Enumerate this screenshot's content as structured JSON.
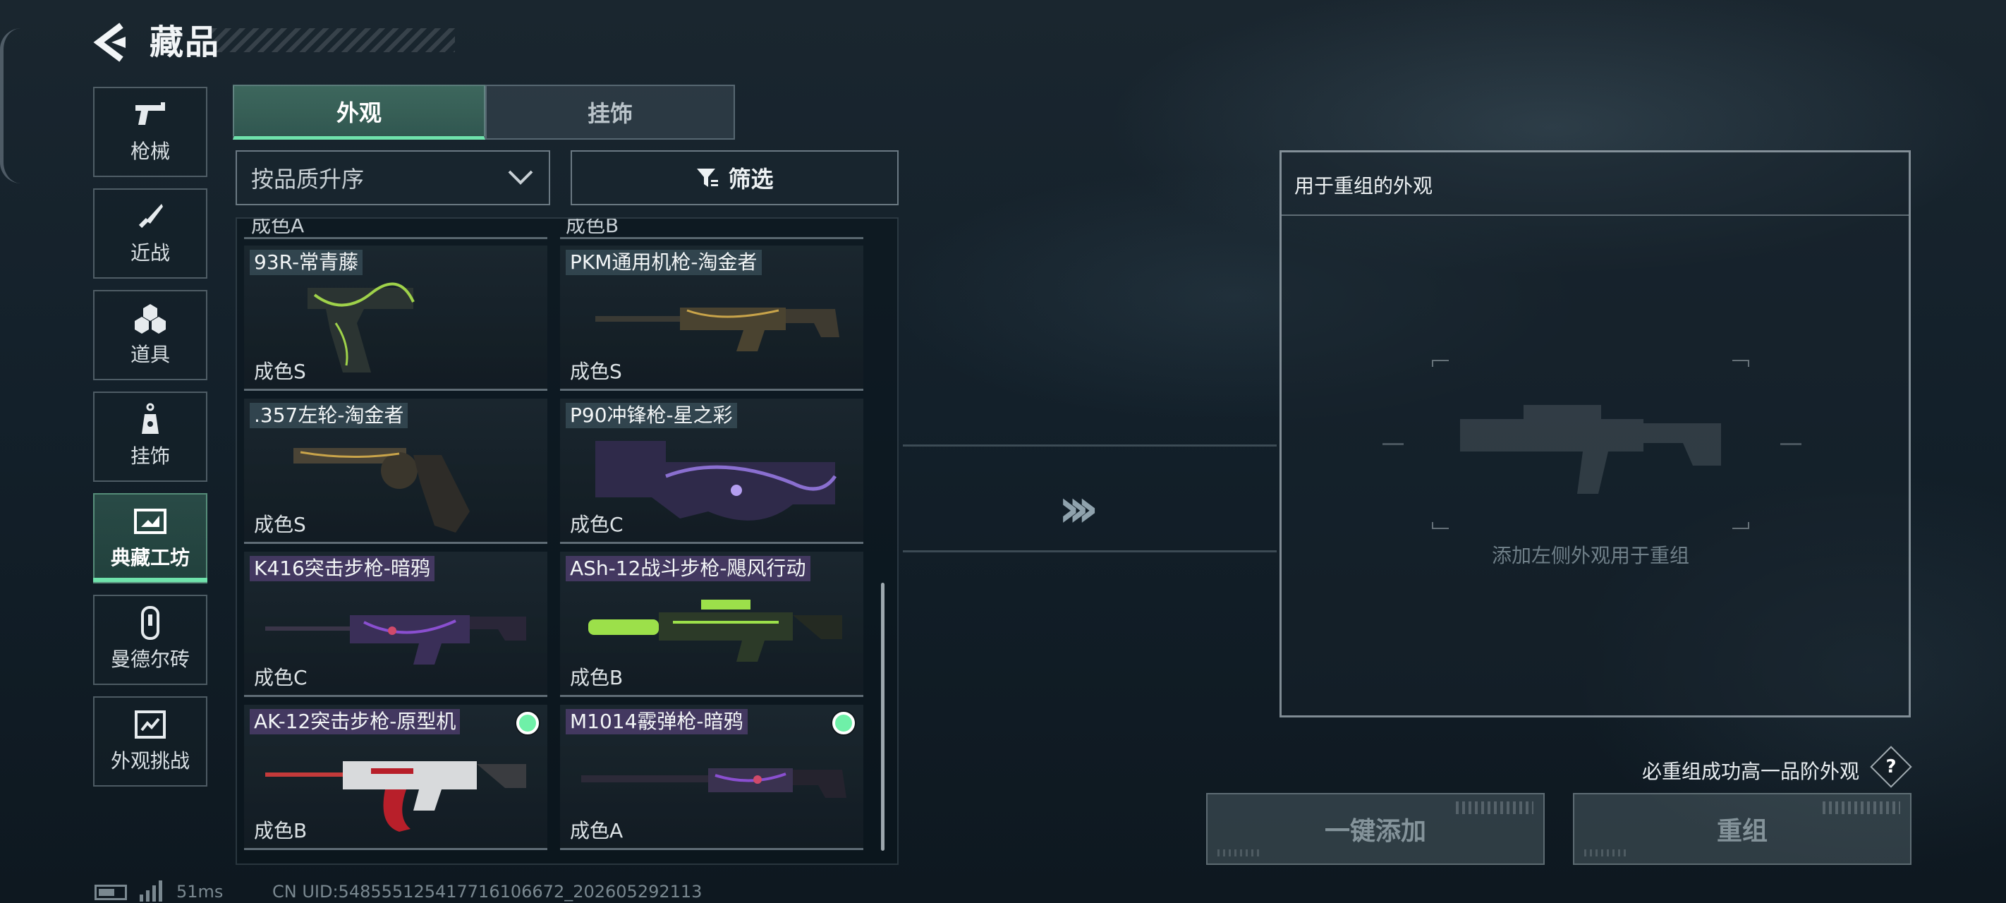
{
  "header": {
    "title": "藏品"
  },
  "categories": [
    {
      "label": "枪械",
      "icon": "pistol-icon",
      "active": false
    },
    {
      "label": "近战",
      "icon": "knife-icon",
      "active": false
    },
    {
      "label": "道具",
      "icon": "grenade-icon",
      "active": false
    },
    {
      "label": "挂饰",
      "icon": "charm-icon",
      "active": false
    },
    {
      "label": "典藏工坊",
      "icon": "workshop-icon",
      "active": true
    },
    {
      "label": "曼德尔砖",
      "icon": "brick-icon",
      "active": false
    },
    {
      "label": "外观挑战",
      "icon": "challenge-icon",
      "active": false
    }
  ],
  "tabs": [
    {
      "label": "外观",
      "active": true
    },
    {
      "label": "挂饰",
      "active": false
    }
  ],
  "sort": {
    "value": "按品质升序"
  },
  "filter": {
    "label": "筛选"
  },
  "grid": {
    "partial_top": [
      "成色A",
      "成色B"
    ],
    "items": [
      {
        "name": "93R-常青藤",
        "grade": "成色S",
        "selected": false,
        "tag_color": "#3e5a62",
        "gun": "pistol-ivy"
      },
      {
        "name": "PKM通用机枪-淘金者",
        "grade": "成色S",
        "selected": false,
        "tag_color": "#3e5a62",
        "gun": "mg-gold"
      },
      {
        "name": ".357左轮-淘金者",
        "grade": "成色S",
        "selected": false,
        "tag_color": "#3e5a62",
        "gun": "revolver-gold"
      },
      {
        "name": "P90冲锋枪-星之彩",
        "grade": "成色C",
        "selected": false,
        "tag_color": "#3e5a62",
        "gun": "p90-cosmic"
      },
      {
        "name": "K416突击步枪-暗鸦",
        "grade": "成色C",
        "selected": false,
        "tag_color": "#5a4478",
        "gun": "rifle-raven"
      },
      {
        "name": "ASh-12战斗步枪-飓风行动",
        "grade": "成色B",
        "selected": false,
        "tag_color": "#5a4478",
        "gun": "rifle-green"
      },
      {
        "name": "AK-12突击步枪-原型机",
        "grade": "成色B",
        "selected": true,
        "tag_color": "#5a4478",
        "gun": "rifle-proto"
      },
      {
        "name": "M1014霰弹枪-暗鸦",
        "grade": "成色A",
        "selected": true,
        "tag_color": "#5a4478",
        "gun": "shotgun-raven"
      }
    ]
  },
  "reassembly": {
    "header": "用于重组的外观",
    "hint": "添加左侧外观用于重组",
    "guarantee": "必重组成功高一品阶外观",
    "help": "?",
    "add_button": "一键添加",
    "reassemble_button": "重组"
  },
  "status": {
    "ping": "51ms",
    "uid": "CN UID:548555125417716106672_202605292113"
  },
  "colors": {
    "accent": "#6fe3ac",
    "selected_dot": "#6ff0a8"
  }
}
